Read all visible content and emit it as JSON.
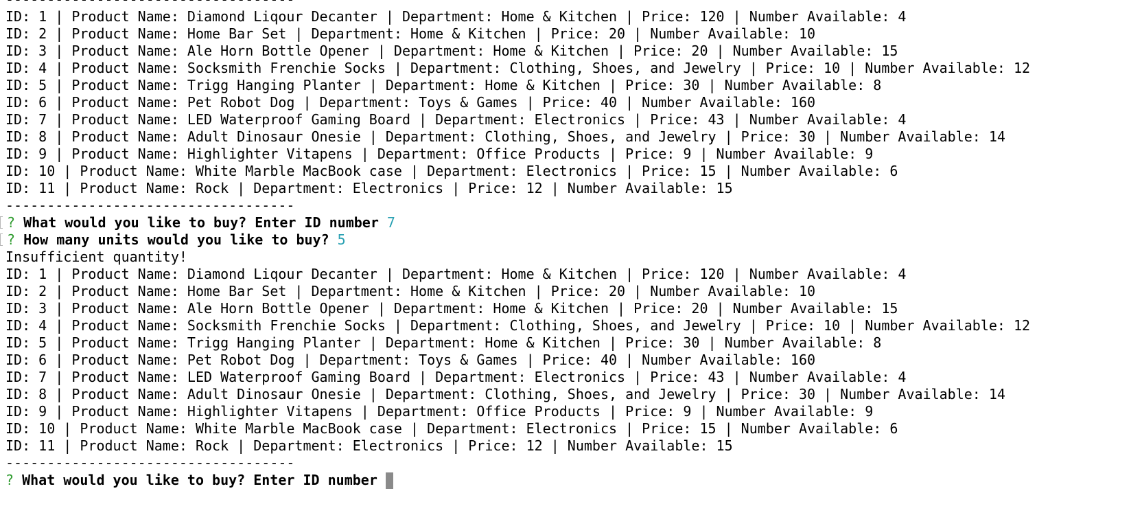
{
  "terminal": {
    "separator": "-----------------------------------",
    "product_lines_first": [
      "ID: 1 | Product Name: Diamond Liqour Decanter | Department: Home & Kitchen | Price: 120 | Number Available: 4",
      "ID: 2 | Product Name: Home Bar Set | Department: Home & Kitchen | Price: 20 | Number Available: 10",
      "ID: 3 | Product Name: Ale Horn Bottle Opener | Department: Home & Kitchen | Price: 20 | Number Available: 15",
      "ID: 4 | Product Name: Socksmith Frenchie Socks | Department: Clothing, Shoes, and Jewelry | Price: 10 | Number Available: 12",
      "ID: 5 | Product Name: Trigg Hanging Planter | Department: Home & Kitchen | Price: 30 | Number Available: 8",
      "ID: 6 | Product Name: Pet Robot Dog | Department: Toys & Games | Price: 40 | Number Available: 160",
      "ID: 7 | Product Name: LED Waterproof Gaming Board | Department: Electronics | Price: 43 | Number Available: 4",
      "ID: 8 | Product Name: Adult Dinosaur Onesie | Department: Clothing, Shoes, and Jewelry | Price: 30 | Number Available: 14",
      "ID: 9 | Product Name: Highlighter Vitapens | Department: Office Products | Price: 9 | Number Available: 9",
      "ID: 10 | Product Name: White Marble MacBook case | Department: Electronics | Price: 15 | Number Available: 6",
      "ID: 11 | Product Name: Rock | Department: Electronics | Price: 12 | Number Available: 15"
    ],
    "prompt_mark": "?",
    "prompt_buy_question": "What would you like to buy? Enter ID number",
    "prompt_buy_answer": "7",
    "prompt_units_question": "How many units would you like to buy?",
    "prompt_units_answer": "5",
    "message": "Insufficient quantity!",
    "product_lines_second": [
      "ID: 1 | Product Name: Diamond Liqour Decanter | Department: Home & Kitchen | Price: 120 | Number Available: 4",
      "ID: 2 | Product Name: Home Bar Set | Department: Home & Kitchen | Price: 20 | Number Available: 10",
      "ID: 3 | Product Name: Ale Horn Bottle Opener | Department: Home & Kitchen | Price: 20 | Number Available: 15",
      "ID: 4 | Product Name: Socksmith Frenchie Socks | Department: Clothing, Shoes, and Jewelry | Price: 10 | Number Available: 12",
      "ID: 5 | Product Name: Trigg Hanging Planter | Department: Home & Kitchen | Price: 30 | Number Available: 8",
      "ID: 6 | Product Name: Pet Robot Dog | Department: Toys & Games | Price: 40 | Number Available: 160",
      "ID: 7 | Product Name: LED Waterproof Gaming Board | Department: Electronics | Price: 43 | Number Available: 4",
      "ID: 8 | Product Name: Adult Dinosaur Onesie | Department: Clothing, Shoes, and Jewelry | Price: 30 | Number Available: 14",
      "ID: 9 | Product Name: Highlighter Vitapens | Department: Office Products | Price: 9 | Number Available: 9",
      "ID: 10 | Product Name: White Marble MacBook case | Department: Electronics | Price: 15 | Number Available: 6",
      "ID: 11 | Product Name: Rock | Department: Electronics | Price: 12 | Number Available: 15"
    ],
    "active_prompt_question": "What would you like to buy? Enter ID number"
  },
  "colors": {
    "background": "#ffffff",
    "text": "#000000",
    "prompt_mark": "#2e9b2e",
    "answer": "#2aa1b3",
    "cursor": "#8a8a8a"
  }
}
